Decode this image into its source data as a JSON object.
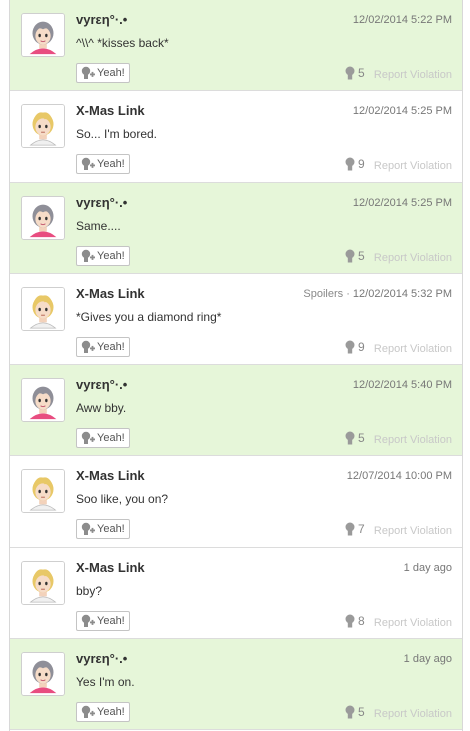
{
  "comments": [
    {
      "username": "vyrεη°·.•",
      "timestamp": "12/02/2014 5:22 PM",
      "spoiler": "",
      "text": "^\\\\^ *kisses back*",
      "yeah_label": "Yeah!",
      "yeah_count": "5",
      "report_label": "Report Violation",
      "own": true,
      "avatar": "girl-mii"
    },
    {
      "username": "X-Mas Link",
      "timestamp": "12/02/2014 5:25 PM",
      "spoiler": "",
      "text": "So... I'm bored.",
      "yeah_label": "Yeah!",
      "yeah_count": "9",
      "report_label": "Report Violation",
      "own": false,
      "avatar": "blonde-mii"
    },
    {
      "username": "vyrεη°·.•",
      "timestamp": "12/02/2014 5:25 PM",
      "spoiler": "",
      "text": "Same....",
      "yeah_label": "Yeah!",
      "yeah_count": "5",
      "report_label": "Report Violation",
      "own": true,
      "avatar": "girl-mii"
    },
    {
      "username": "X-Mas Link",
      "timestamp": "12/02/2014 5:32 PM",
      "spoiler": "Spoilers · ",
      "text": "*Gives you a diamond ring*",
      "yeah_label": "Yeah!",
      "yeah_count": "9",
      "report_label": "Report Violation",
      "own": false,
      "avatar": "blonde-mii"
    },
    {
      "username": "vyrεη°·.•",
      "timestamp": "12/02/2014 5:40 PM",
      "spoiler": "",
      "text": "Aww bby.",
      "yeah_label": "Yeah!",
      "yeah_count": "5",
      "report_label": "Report Violation",
      "own": true,
      "avatar": "girl-mii"
    },
    {
      "username": "X-Mas Link",
      "timestamp": "12/07/2014 10:00 PM",
      "spoiler": "",
      "text": "Soo like, you on?",
      "yeah_label": "Yeah!",
      "yeah_count": "7",
      "report_label": "Report Violation",
      "own": false,
      "avatar": "blonde-mii"
    },
    {
      "username": "X-Mas Link",
      "timestamp": "1 day ago",
      "spoiler": "",
      "text": "bby?",
      "yeah_label": "Yeah!",
      "yeah_count": "8",
      "report_label": "Report Violation",
      "own": false,
      "avatar": "blonde-mii"
    },
    {
      "username": "vyrεη°·.•",
      "timestamp": "1 day ago",
      "spoiler": "",
      "text": "Yes I'm on.",
      "yeah_label": "Yeah!",
      "yeah_count": "5",
      "report_label": "Report Violation",
      "own": true,
      "avatar": "girl-mii"
    }
  ],
  "colors": {
    "own_comment_bg": "#e6f6d9",
    "other_comment_bg": "#ffffff",
    "report_link": "#c8c8c8"
  }
}
